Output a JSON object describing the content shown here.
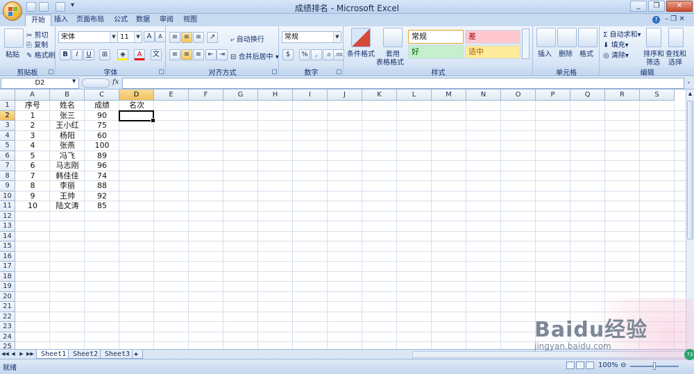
{
  "window": {
    "title": "成绩排名 - Microsoft Excel"
  },
  "tabs": [
    "开始",
    "插入",
    "页面布局",
    "公式",
    "数据",
    "审阅",
    "视图"
  ],
  "ribbon": {
    "clipboard": {
      "label": "剪贴板",
      "paste": "粘贴",
      "cut": "剪切",
      "copy": "复制",
      "format_painter": "格式刷"
    },
    "font": {
      "label": "字体",
      "name": "宋体",
      "size": "11"
    },
    "alignment": {
      "label": "对齐方式",
      "wrap": "自动换行",
      "merge": "合并后居中"
    },
    "number": {
      "label": "数字",
      "format": "常规"
    },
    "styles": {
      "label": "样式",
      "conditional": "条件格式",
      "as_table_1": "套用",
      "as_table_2": "表格格式",
      "normal": "常规",
      "bad": "差",
      "good": "好",
      "neutral": "适中"
    },
    "cells": {
      "label": "单元格",
      "insert": "插入",
      "delete": "删除",
      "format": "格式"
    },
    "editing": {
      "label": "编辑",
      "autosum": "自动求和",
      "fill": "填充",
      "clear": "清除",
      "sort_1": "排序和",
      "sort_2": "筛选",
      "find_1": "查找和",
      "find_2": "选择"
    }
  },
  "formula_bar": {
    "name_box": "D2",
    "fx": "fx",
    "value": ""
  },
  "columns": [
    "A",
    "B",
    "C",
    "D",
    "E",
    "F",
    "G",
    "H",
    "I",
    "J",
    "K",
    "L",
    "M",
    "N",
    "O",
    "P",
    "Q",
    "R",
    "S"
  ],
  "rows": [
    "1",
    "2",
    "3",
    "4",
    "5",
    "6",
    "7",
    "8",
    "9",
    "10",
    "11",
    "12",
    "13",
    "14",
    "15",
    "16",
    "17",
    "18",
    "19",
    "20",
    "21",
    "22",
    "23",
    "24",
    "25"
  ],
  "table": {
    "headers": [
      "序号",
      "姓名",
      "成绩",
      "名次"
    ],
    "data": [
      [
        "1",
        "张三",
        "90"
      ],
      [
        "2",
        "王小红",
        "75"
      ],
      [
        "3",
        "杨阳",
        "60"
      ],
      [
        "4",
        "张燕",
        "100"
      ],
      [
        "5",
        "冯飞",
        "89"
      ],
      [
        "6",
        "马志刚",
        "96"
      ],
      [
        "7",
        "韩佳佳",
        "74"
      ],
      [
        "8",
        "李丽",
        "88"
      ],
      [
        "9",
        "王帅",
        "92"
      ],
      [
        "10",
        "陆文涛",
        "85"
      ]
    ]
  },
  "active_cell": "D2",
  "sheets": [
    "Sheet1",
    "Sheet2",
    "Sheet3"
  ],
  "status": {
    "ready": "就绪",
    "zoom": "100%"
  },
  "watermark": {
    "brand": "Baidu经验",
    "url": "jingyan.baidu.com",
    "badge": "73"
  },
  "colors": {
    "title_bg": "#bcd3ee",
    "ribbon_bg": "#dae7f7",
    "selected_header": "#f1c15f",
    "bad_bg": "#ffc7ce",
    "good_bg": "#c6efce",
    "neutral_bg": "#ffeb9c"
  }
}
